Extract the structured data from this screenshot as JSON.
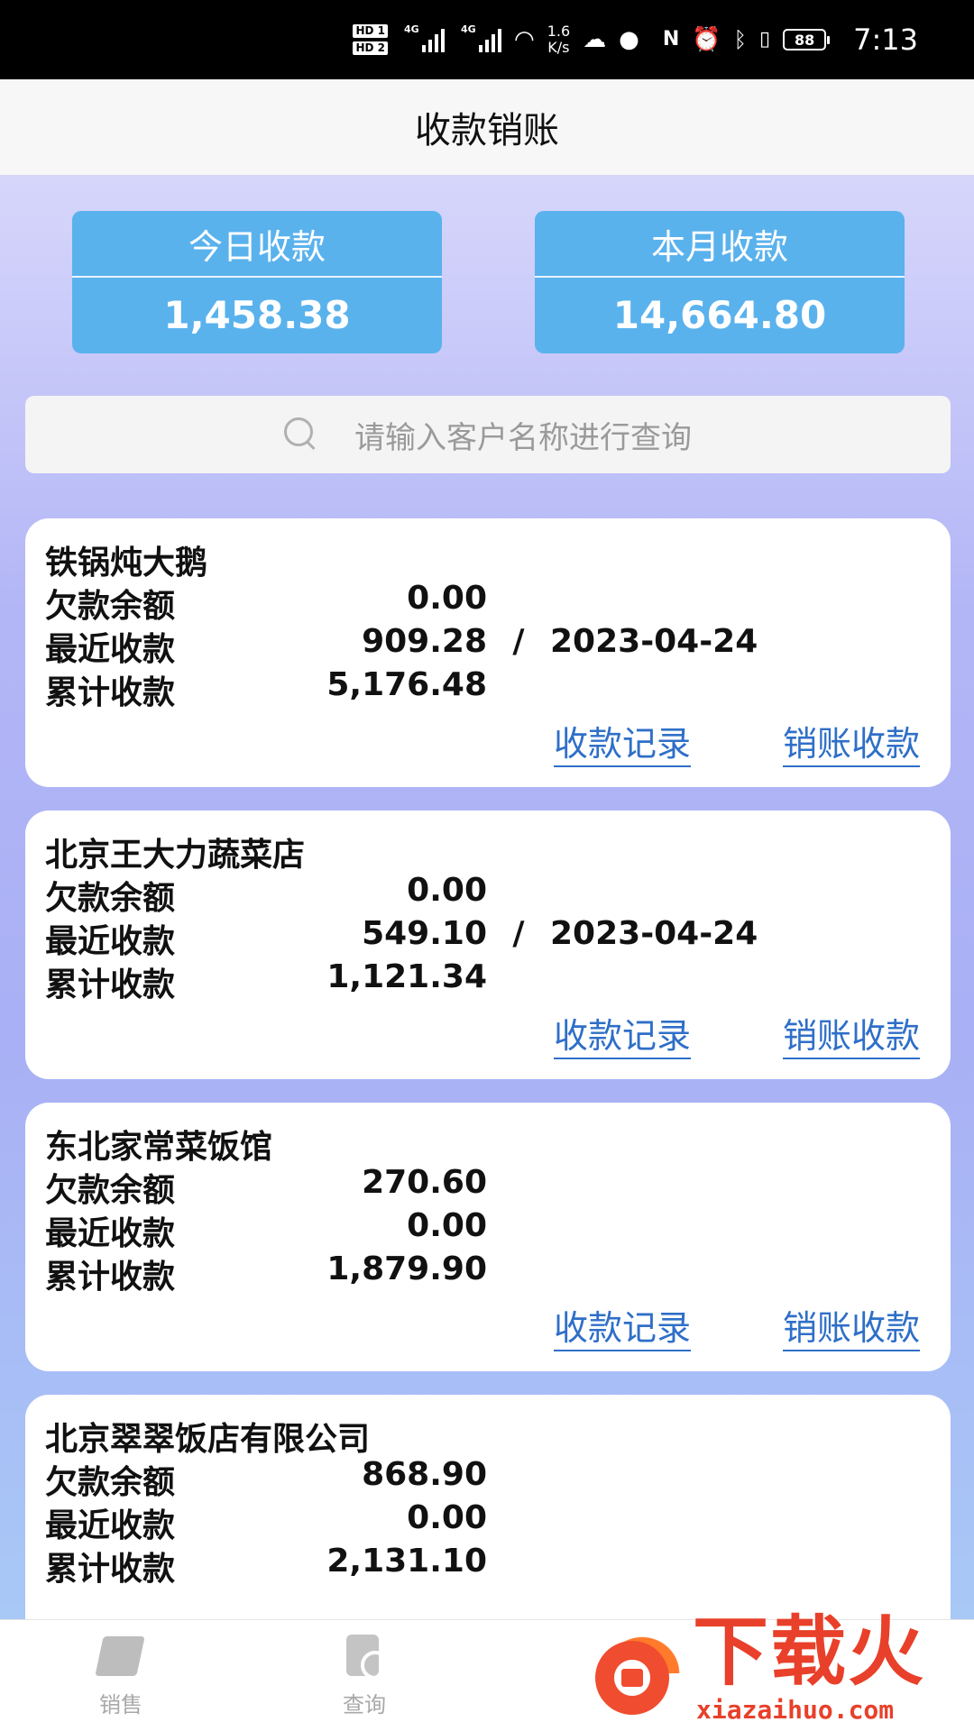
{
  "status_bar": {
    "hd1": "HD 1",
    "hd2": "HD 2",
    "net1": "4G",
    "net2": "4G",
    "speed_value": "1.6",
    "speed_unit": "K/s",
    "battery": "88",
    "time": "7:13",
    "icons": [
      "wechat-icon",
      "message-icon",
      "nfc-icon",
      "alarm-icon",
      "bluetooth-icon",
      "vibrate-icon"
    ]
  },
  "header": {
    "title": "收款销账"
  },
  "summary": {
    "today_label": "今日收款",
    "today_value": "1,458.38",
    "month_label": "本月收款",
    "month_value": "14,664.80"
  },
  "search": {
    "placeholder": "请输入客户名称进行查询"
  },
  "customers": [
    {
      "name": "铁锅炖大鹅",
      "debt_label": "欠款余额",
      "debt": "0.00",
      "recent_label": "最近收款",
      "recent": "909.28",
      "sep": "/",
      "recent_date": "2023-04-24",
      "total_label": "累计收款",
      "total": "5,176.48",
      "records_link": "收款记录",
      "writeoff_link": "销账收款"
    },
    {
      "name": "北京王大力蔬菜店",
      "debt_label": "欠款余额",
      "debt": "0.00",
      "recent_label": "最近收款",
      "recent": "549.10",
      "sep": "/",
      "recent_date": "2023-04-24",
      "total_label": "累计收款",
      "total": "1,121.34",
      "records_link": "收款记录",
      "writeoff_link": "销账收款"
    },
    {
      "name": "东北家常菜饭馆",
      "debt_label": "欠款余额",
      "debt": "270.60",
      "recent_label": "最近收款",
      "recent": "0.00",
      "total_label": "累计收款",
      "total": "1,879.90",
      "records_link": "收款记录",
      "writeoff_link": "销账收款"
    },
    {
      "name": "北京翠翠饭店有限公司",
      "debt_label": "欠款余额",
      "debt": "868.90",
      "recent_label": "最近收款",
      "recent": "0.00",
      "total_label": "累计收款",
      "total": "2,131.10"
    }
  ],
  "bottom_nav": {
    "sales_label": "销售",
    "query_label": "查询"
  },
  "watermark": {
    "text": "下载火",
    "url": "xiazaihuo.com"
  },
  "colors": {
    "summary_bg": "#5ab2ed",
    "link": "#2f6fc8",
    "watermark": "#e8402a"
  }
}
